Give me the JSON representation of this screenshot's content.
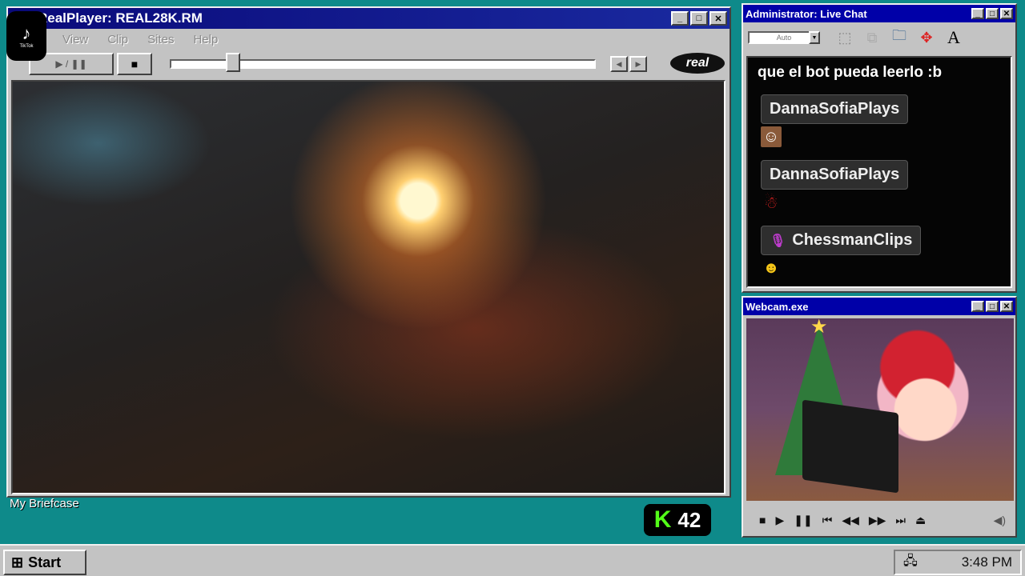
{
  "realplayer": {
    "title": "RealPlayer: REAL28K.RM",
    "menu": [
      "View",
      "Clip",
      "Sites",
      "Help"
    ],
    "play_pause_label": "▶ / ❚❚",
    "stop_label": "■",
    "logo_text": "real",
    "progress": 0.15
  },
  "tiktok": {
    "label": "TikTok"
  },
  "chat": {
    "title": "Administrator: Live Chat",
    "font_value": "Auto",
    "partial_message": "que el bot pueda leerlo :b",
    "messages": [
      {
        "user": "DannaSofiaPlays",
        "emote": "man-face-emote",
        "mic": false
      },
      {
        "user": "DannaSofiaPlays",
        "emote": "santa-emote",
        "mic": false
      },
      {
        "user": "ChessmanClips",
        "emote": "laughing-emote",
        "mic": true
      }
    ]
  },
  "webcam": {
    "title": "Webcam.exe"
  },
  "desktop": {
    "briefcase_label": "My Briefcase"
  },
  "kick": {
    "letter": "K",
    "count": "42"
  },
  "taskbar": {
    "start_label": "Start",
    "clock": "3:48 PM"
  },
  "colors": {
    "desktop": "#0e8a8a",
    "kick_green": "#53fc18",
    "title_blue": "#0000a8"
  }
}
